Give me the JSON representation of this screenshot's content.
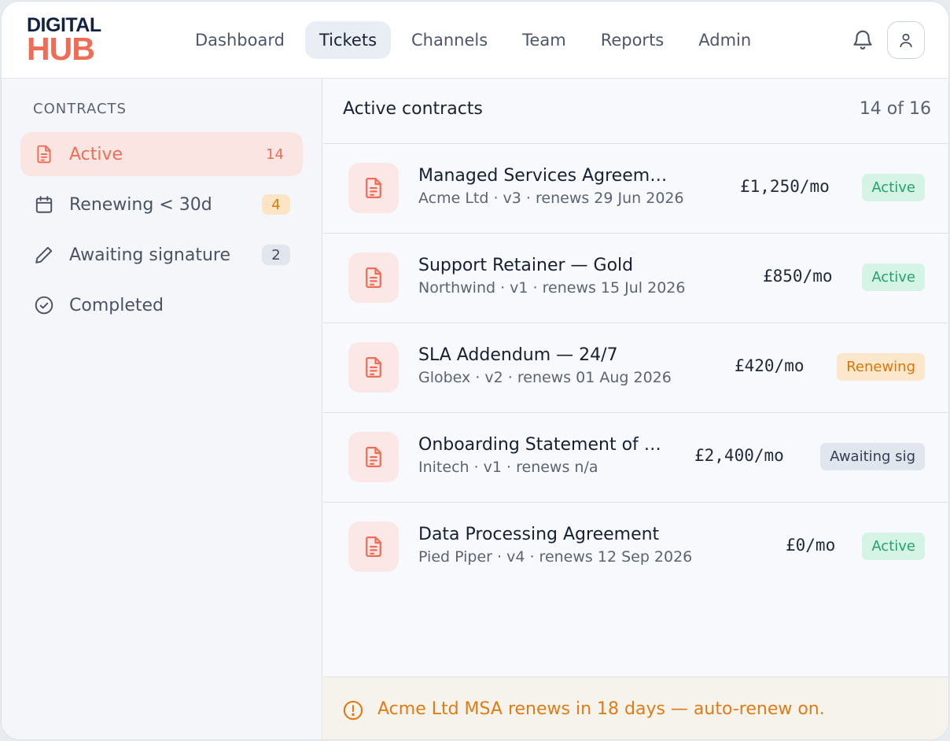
{
  "brand": {
    "line1": "DIGITAL",
    "line2": "HUB"
  },
  "nav": {
    "items": [
      {
        "label": "Dashboard",
        "active": false
      },
      {
        "label": "Tickets",
        "active": true
      },
      {
        "label": "Channels",
        "active": false
      },
      {
        "label": "Team",
        "active": false
      },
      {
        "label": "Reports",
        "active": false
      },
      {
        "label": "Admin",
        "active": false
      }
    ]
  },
  "header_icons": {
    "notifications": "bell-icon",
    "account": "user-icon"
  },
  "sidebar": {
    "heading": "CONTRACTS",
    "items": [
      {
        "label": "Active",
        "count": "14",
        "icon": "document-icon",
        "active": true
      },
      {
        "label": "Renewing < 30d",
        "count": "4",
        "icon": "calendar-icon",
        "active": false
      },
      {
        "label": "Awaiting signature",
        "count": "2",
        "icon": "pen-icon",
        "active": false
      },
      {
        "label": "Completed",
        "count": "",
        "icon": "check-circle-icon",
        "active": false
      }
    ]
  },
  "main": {
    "title": "Active contracts",
    "count_text": "14 of 16",
    "rows": [
      {
        "title": "Managed Services Agreement",
        "sub": "Acme Ltd · v3 · renews 29 Jun 2026",
        "price": "£1,250/mo",
        "status": "Active"
      },
      {
        "title": "Support Retainer — Gold",
        "sub": "Northwind · v1 · renews 15 Jul 2026",
        "price": "£850/mo",
        "status": "Active"
      },
      {
        "title": "SLA Addendum — 24/7",
        "sub": "Globex · v2 · renews 01 Aug 2026",
        "price": "£420/mo",
        "status": "Renewing"
      },
      {
        "title": "Onboarding Statement of …",
        "sub": "Initech · v1 · renews n/a",
        "price": "£2,400/mo",
        "status": "Awaiting sig"
      },
      {
        "title": "Data Processing Agreement",
        "sub": "Pied Piper · v4 · renews 12 Sep 2026",
        "price": "£0/mo",
        "status": "Active"
      }
    ]
  },
  "notice": {
    "text": "Acme Ltd MSA renews in 18 days — auto-renew on.",
    "icon": "alert-circle-icon"
  },
  "colors": {
    "accent": "#ef6c56",
    "brand_dark": "#13233f",
    "status_active": "#22a36b",
    "status_renewing": "#d97706",
    "warning_text": "#e07b16"
  }
}
